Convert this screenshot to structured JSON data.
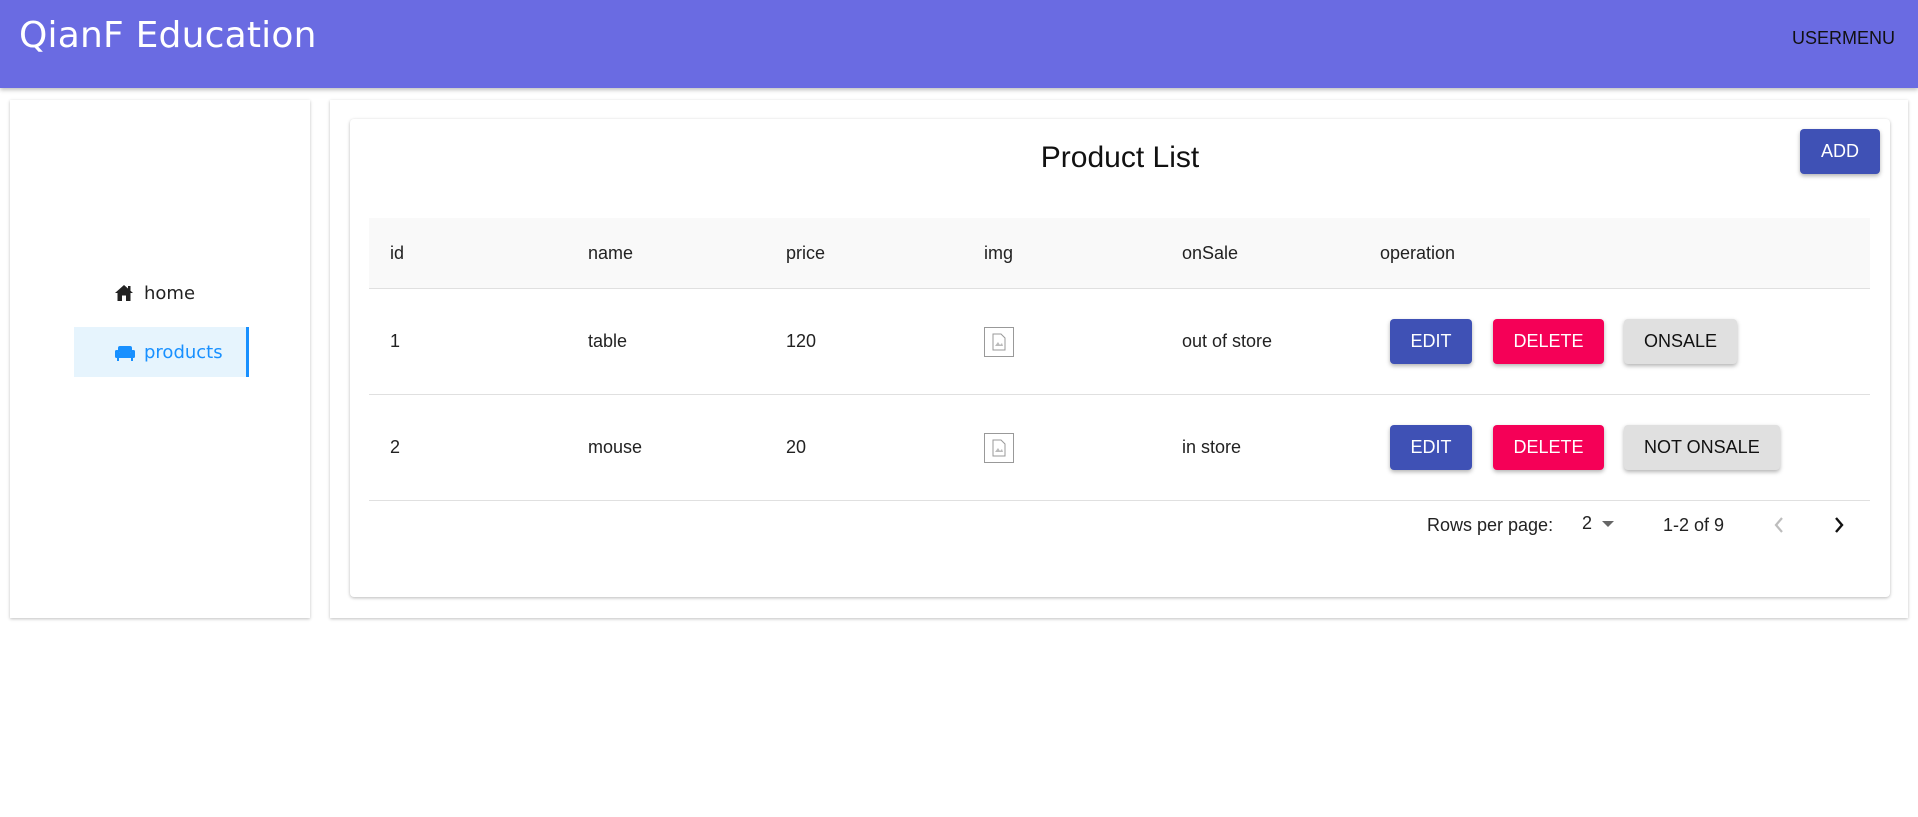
{
  "header": {
    "brand": "QianF Education",
    "user_menu": "USERMENU"
  },
  "sidebar": {
    "items": [
      {
        "label": "home",
        "icon": "home-icon"
      },
      {
        "label": "products",
        "icon": "sofa-icon",
        "active": true
      }
    ]
  },
  "main": {
    "title": "Product List",
    "add_label": "ADD",
    "columns": [
      "id",
      "name",
      "price",
      "img",
      "onSale",
      "operation"
    ],
    "rows": [
      {
        "id": "1",
        "name": "table",
        "price": "120",
        "onSale": "out of store",
        "edit": "EDIT",
        "delete": "DELETE",
        "toggle": "ONSALE"
      },
      {
        "id": "2",
        "name": "mouse",
        "price": "20",
        "onSale": "in store",
        "edit": "EDIT",
        "delete": "DELETE",
        "toggle": "NOT ONSALE"
      }
    ],
    "pagination": {
      "rows_per_page_label": "Rows per page:",
      "rows_per_page": "2",
      "range": "1-2 of 9"
    }
  },
  "colors": {
    "header": "#6a6be2",
    "primary": "#3f51b5",
    "secondary": "#f50057",
    "active_nav": "#1890ff"
  }
}
